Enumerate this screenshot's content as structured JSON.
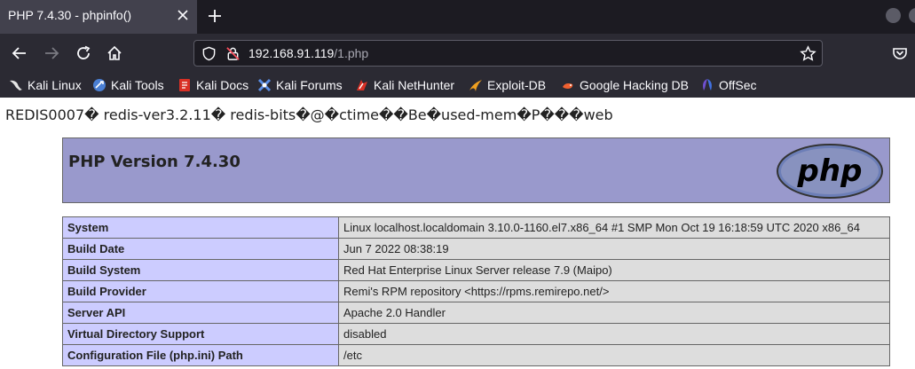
{
  "browser": {
    "tab_title": "PHP 7.4.30 - phpinfo()",
    "url_host": "192.168.91.119",
    "url_path": "/1.php"
  },
  "bookmarks": [
    {
      "label": "Kali Linux",
      "icon": "kali-dragon-icon",
      "color": "#e5e5e5"
    },
    {
      "label": "Kali Tools",
      "icon": "kali-tools-icon",
      "color": "#4a7fd4"
    },
    {
      "label": "Kali Docs",
      "icon": "kali-docs-icon",
      "color": "#d93025"
    },
    {
      "label": "Kali Forums",
      "icon": "kali-forums-icon",
      "color": "#5b8fe8"
    },
    {
      "label": "Kali NetHunter",
      "icon": "kali-nethunter-icon",
      "color": "#d93025"
    },
    {
      "label": "Exploit-DB",
      "icon": "exploit-db-icon",
      "color": "#f0a020"
    },
    {
      "label": "Google Hacking DB",
      "icon": "ghdb-icon",
      "color": "#f06030"
    },
    {
      "label": "OffSec",
      "icon": "offsec-icon",
      "color": "#7050d0"
    }
  ],
  "page": {
    "redis_line": "REDIS0007� redis-ver3.2.11� redis-bits�@�ctime��Be�used-mem�P���web",
    "php_version": "PHP Version 7.4.30",
    "logo_text": "php",
    "rows": [
      {
        "key": "System",
        "value": "Linux localhost.localdomain 3.10.0-1160.el7.x86_64 #1 SMP Mon Oct 19 16:18:59 UTC 2020 x86_64"
      },
      {
        "key": "Build Date",
        "value": "Jun 7 2022 08:38:19"
      },
      {
        "key": "Build System",
        "value": "Red Hat Enterprise Linux Server release 7.9 (Maipo)"
      },
      {
        "key": "Build Provider",
        "value": "Remi's RPM repository <https://rpms.remirepo.net/>"
      },
      {
        "key": "Server API",
        "value": "Apache 2.0 Handler"
      },
      {
        "key": "Virtual Directory Support",
        "value": "disabled"
      },
      {
        "key": "Configuration File (php.ini) Path",
        "value": "/etc"
      }
    ]
  },
  "colors": {
    "header_bg": "#9999cc",
    "key_cell_bg": "#ccccff",
    "value_cell_bg": "#dddddd"
  }
}
